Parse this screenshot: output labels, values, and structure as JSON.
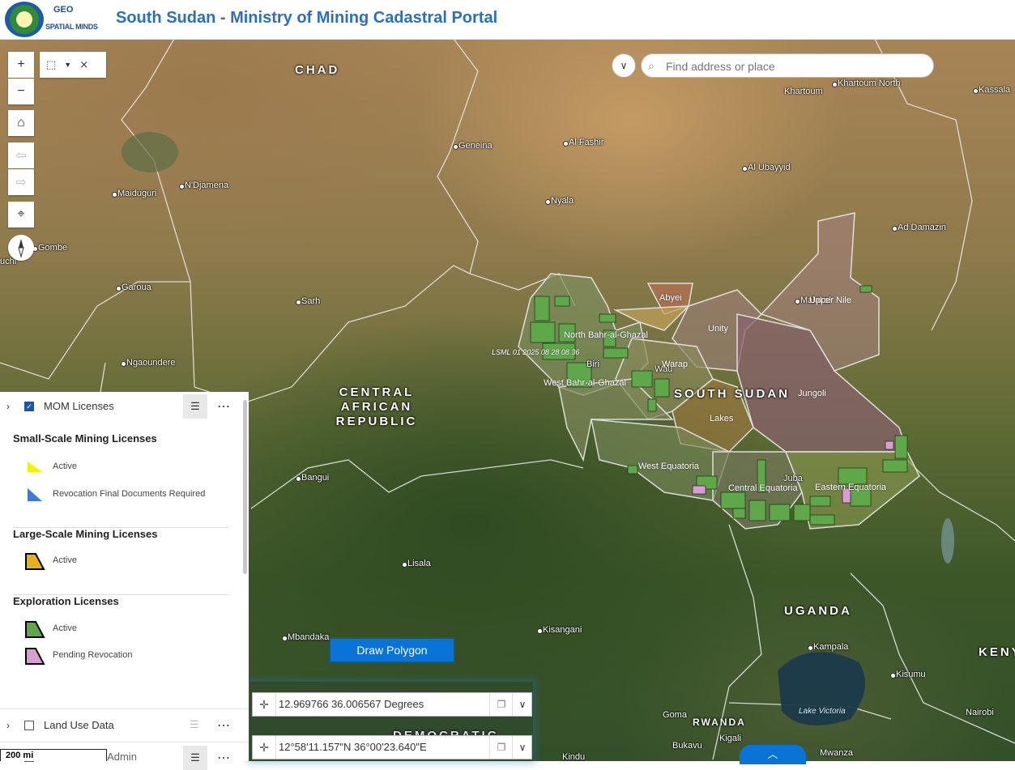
{
  "header": {
    "title": "South Sudan - Ministry of Mining Cadastral Portal",
    "logo2_top": "GEO",
    "logo2_bottom": "SPATIAL MINDS"
  },
  "search": {
    "placeholder": "Find address or place"
  },
  "map_labels": {
    "countries": {
      "chad": "CHAD",
      "car": "CENTRAL AFRICAN REPUBLIC",
      "south_sudan": "SOUTH SUDAN",
      "uganda": "UGANDA",
      "kenya": "KENY",
      "drc": "DEMOCRATIC",
      "rwanda": "RWANDA"
    },
    "cities": [
      "Khartoum North",
      "Khartoum",
      "Kassala",
      "Geneina",
      "Al Fashir",
      "Al Ubayyid",
      "N'Djamena",
      "Maiduguri",
      "Nyala",
      "Ad Damazin",
      "Gombe",
      "Sarh",
      "Garoua",
      "Ngaoundere",
      "Bangui",
      "Lisala",
      "Mbandaka",
      "Kisangani",
      "Kampala",
      "Kisumu",
      "Nairobi",
      "Goma",
      "Kigali",
      "Bukavu",
      "Kindu",
      "Mwanza",
      "Malakal",
      "Wau",
      "Juba",
      "uchi",
      "Biri"
    ],
    "states": [
      "Abyei",
      "Upper Nile",
      "Unity",
      "North Bahr-al-Ghazal",
      "Warap",
      "West Bahr-al-Ghazal",
      "Jungoli",
      "Lakes",
      "West Equatoria",
      "Central Equatoria",
      "Eastern Equatoria"
    ],
    "lake": "Lake Victoria",
    "license_tag": "LSML 01 2025 08 28 08 36"
  },
  "legend": {
    "layer1": {
      "label": "MOM Licenses",
      "checked": true
    },
    "groups": [
      {
        "title": "Small-Scale Mining Licenses",
        "items": [
          {
            "label": "Active",
            "color": "#f2f200"
          },
          {
            "label": "Revocation Final Documents Required",
            "color": "#3f7ad6"
          }
        ]
      },
      {
        "title": "Large-Scale Mining Licenses",
        "items": [
          {
            "label": "Active",
            "color": "#e7b11c"
          }
        ]
      },
      {
        "title": "Exploration Licenses",
        "items": [
          {
            "label": "Active",
            "color": "#5fa84a"
          },
          {
            "label": "Pending Revocation",
            "color": "#d7a0d0"
          }
        ]
      }
    ],
    "layer2": {
      "label": "Land Use Data",
      "checked": false
    },
    "layer3": {
      "label": "South Sudan Admin",
      "checked": false
    }
  },
  "tools": {
    "draw_polygon": "Draw Polygon",
    "coord_decimal": "12.969766 36.006567 Degrees",
    "coord_dms": "12°58'11.157\"N 36°00'23.640\"E",
    "scale": "200 mi"
  },
  "colors": {
    "title": "#2a6fc0",
    "accent": "#0a73d8",
    "exploration_active": "#5fa84a",
    "pending_revocation": "#d7a0d0"
  }
}
